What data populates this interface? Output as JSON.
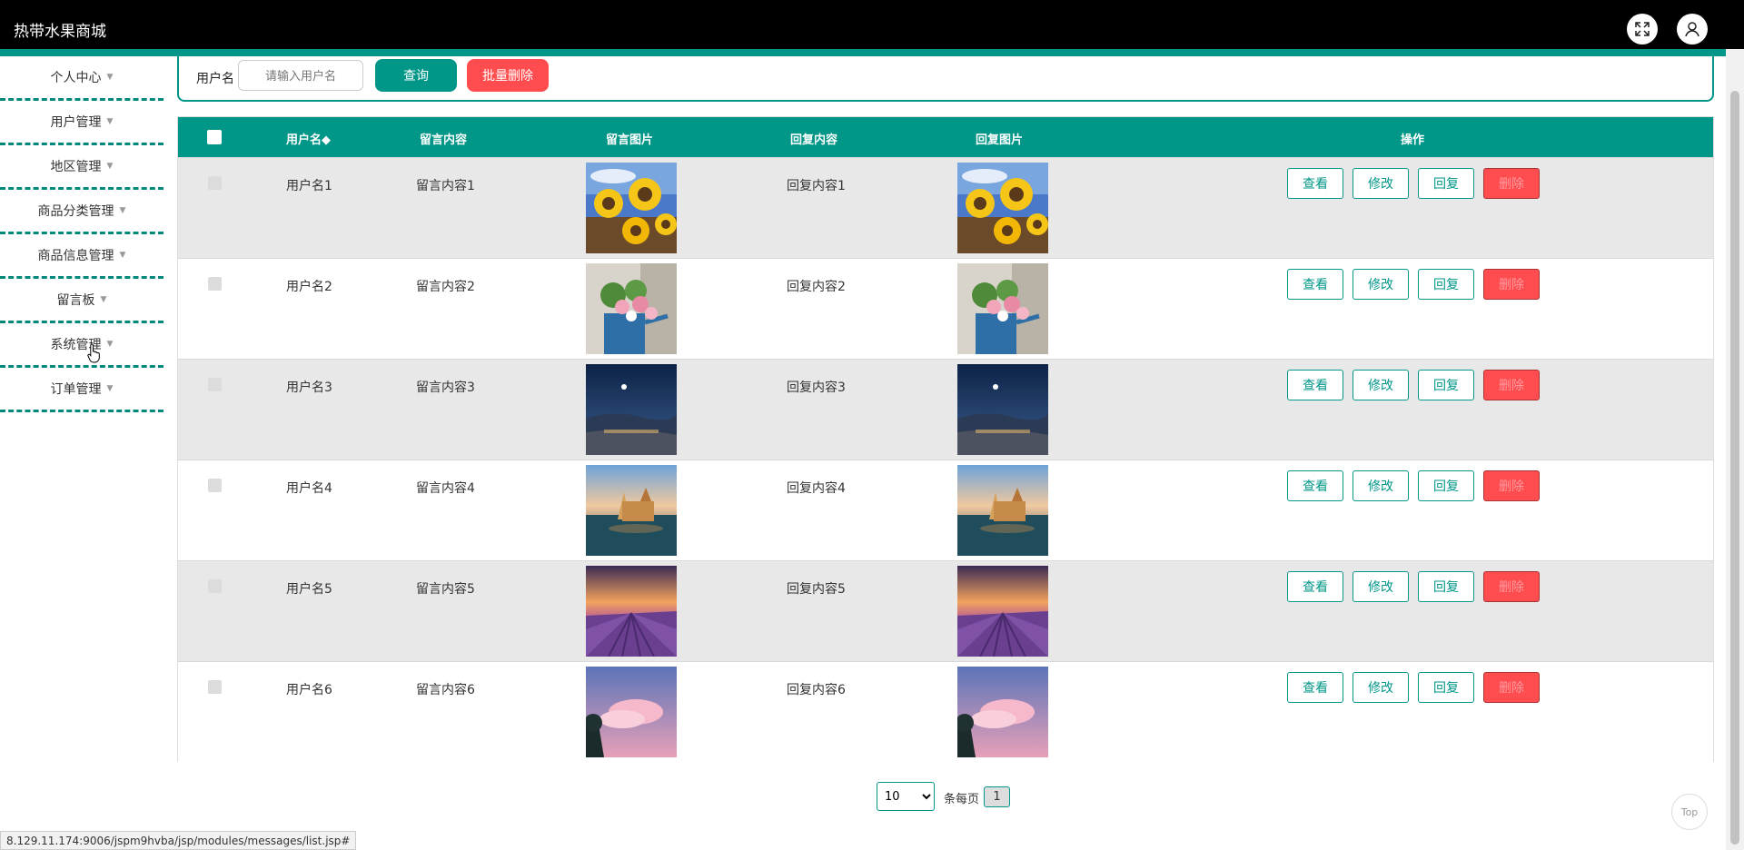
{
  "header": {
    "title": "热带水果商城"
  },
  "sidebar": {
    "items": [
      {
        "label": "个人中心"
      },
      {
        "label": "用户管理"
      },
      {
        "label": "地区管理"
      },
      {
        "label": "商品分类管理"
      },
      {
        "label": "商品信息管理"
      },
      {
        "label": "留言板"
      },
      {
        "label": "系统管理"
      },
      {
        "label": "订单管理"
      }
    ]
  },
  "search": {
    "label": "用户名",
    "placeholder": "请输入用户名",
    "query_label": "查询",
    "batch_delete_label": "批量删除"
  },
  "table": {
    "headers": {
      "username": "用户名◆",
      "content": "留言内容",
      "image": "留言图片",
      "reply": "回复内容",
      "reply_image": "回复图片",
      "actions": "操作"
    },
    "rows": [
      {
        "username": "用户名1",
        "content": "留言内容1",
        "reply": "回复内容1",
        "image": "sunflowers-photo"
      },
      {
        "username": "用户名2",
        "content": "留言内容2",
        "reply": "回复内容2",
        "image": "flower-watering-can-photo"
      },
      {
        "username": "用户名3",
        "content": "留言内容3",
        "reply": "回复内容3",
        "image": "night-coast-photo"
      },
      {
        "username": "用户名4",
        "content": "留言内容4",
        "reply": "回复内容4",
        "image": "lake-castle-photo"
      },
      {
        "username": "用户名5",
        "content": "留言内容5",
        "reply": "回复内容5",
        "image": "lavender-field-photo"
      },
      {
        "username": "用户名6",
        "content": "留言内容6",
        "reply": "回复内容6",
        "image": "pink-clouds-photo"
      }
    ],
    "actions": {
      "view": "查看",
      "edit": "修改",
      "reply": "回复",
      "delete": "删除"
    }
  },
  "pagination": {
    "page_size": "10",
    "page_size_options": [
      "10"
    ],
    "per_page_label": "条每页",
    "current_page": "1"
  },
  "top_button": "Top",
  "status_url": "8.129.11.174:9006/jspm9hvba/jsp/modules/messages/list.jsp#",
  "colors": {
    "primary": "#009688",
    "danger": "#ff4d4f",
    "header_bg": "#000000"
  }
}
